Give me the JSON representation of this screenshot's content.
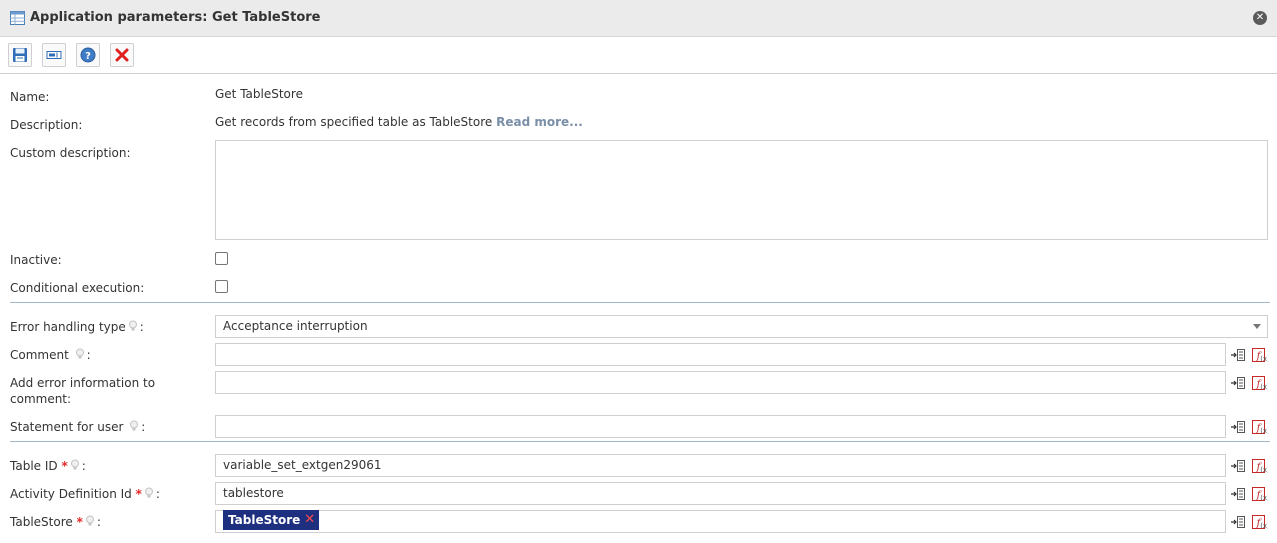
{
  "window": {
    "title": "Application parameters: Get TableStore",
    "title_icon": "table-icon",
    "close_icon": "close-icon"
  },
  "toolbar": {
    "buttons": [
      {
        "name": "save-button",
        "icon": "save-icon"
      },
      {
        "name": "input-button",
        "icon": "input-field-icon"
      },
      {
        "name": "help-button",
        "icon": "help-icon"
      },
      {
        "name": "delete-button",
        "icon": "delete-icon"
      }
    ]
  },
  "form": {
    "name_label": "Name:",
    "name_value": "Get TableStore",
    "description_label": "Description:",
    "description_value": "Get records from specified table as TableStore",
    "read_more": "Read more...",
    "custom_description_label": "Custom description:",
    "custom_description_value": "",
    "inactive_label": "Inactive:",
    "inactive_checked": false,
    "conditional_label": "Conditional execution:",
    "conditional_checked": false,
    "error_type_label": "Error handling type",
    "error_type_value": "Acceptance interruption",
    "comment_label": "Comment",
    "comment_value": "",
    "add_error_label": "Add error information to comment:",
    "add_error_value": "",
    "statement_label": "Statement for user",
    "statement_value": "",
    "table_id_label": "Table ID",
    "table_id_value": "variable_set_extgen29061",
    "activity_def_label": "Activity Definition Id",
    "activity_def_value": "tablestore",
    "tablestore_label": "TableStore",
    "tablestore_tag": "TableStore",
    "required_mark": "*",
    "colon": ":"
  },
  "colors": {
    "accent": "#1d2f7e",
    "required": "#e32626",
    "link": "#7a8fa8",
    "divider": "#9fb6c8"
  }
}
